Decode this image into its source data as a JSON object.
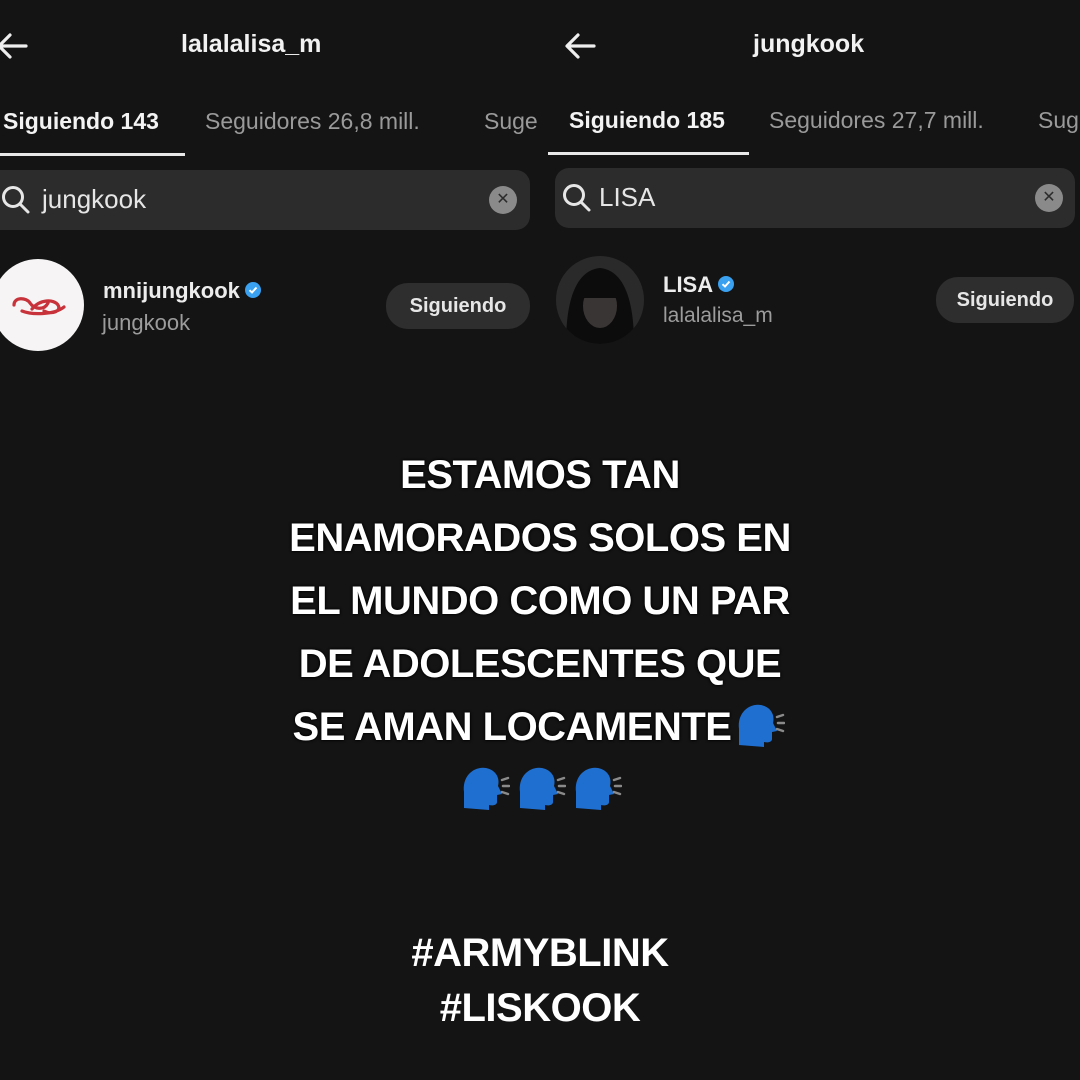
{
  "left": {
    "title": "lalalalisa_m",
    "tabs": [
      "Siguiendo 143",
      "Seguidores 26,8 mill.",
      "Suge"
    ],
    "search_value": "jungkook",
    "result": {
      "name": "mnijungkook",
      "handle": "jungkook",
      "button": "Siguiendo"
    }
  },
  "right": {
    "title": "jungkook",
    "tabs": [
      "Siguiendo 185",
      "Seguidores 27,7 mill.",
      "Sug"
    ],
    "search_value": "LISA",
    "result": {
      "name": "LISA",
      "handle": "lalalalisa_m",
      "button": "Siguiendo"
    }
  },
  "caption": {
    "lines": [
      "ESTAMOS TAN",
      "ENAMORADOS SOLOS EN",
      "EL MUNDO COMO UN PAR",
      "DE ADOLESCENTES QUE",
      "SE AMAN LOCAMENTE"
    ],
    "emoji_icon": "speaking-head-icon"
  },
  "hashtags": [
    "#ARMYBLINK",
    "#LISKOOK"
  ],
  "colors": {
    "background": "#141414",
    "search_bg": "#2c2c2c",
    "verified": "#3aa0f0"
  }
}
